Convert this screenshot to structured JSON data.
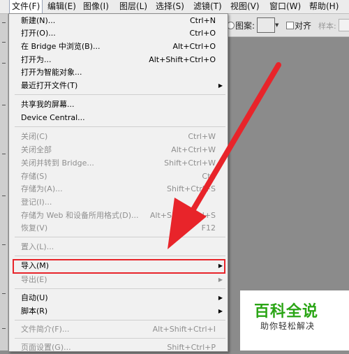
{
  "menubar": {
    "items": [
      {
        "label": "文件(F)"
      },
      {
        "label": "编辑(E)"
      },
      {
        "label": "图像(I)"
      },
      {
        "label": "图层(L)"
      },
      {
        "label": "选择(S)"
      },
      {
        "label": "滤镜(T)"
      },
      {
        "label": "视图(V)"
      },
      {
        "label": "窗口(W)"
      },
      {
        "label": "帮助(H)"
      }
    ]
  },
  "options_bar": {
    "pattern_label": "图案:",
    "align_label": "对齐",
    "sample_label": "样本:"
  },
  "file_menu": {
    "items": [
      {
        "label": "新建(N)...",
        "shortcut": "Ctrl+N",
        "disabled": false
      },
      {
        "label": "打开(O)...",
        "shortcut": "Ctrl+O",
        "disabled": false
      },
      {
        "label": "在 Bridge 中浏览(B)...",
        "shortcut": "Alt+Ctrl+O",
        "disabled": false
      },
      {
        "label": "打开为...",
        "shortcut": "Alt+Shift+Ctrl+O",
        "disabled": false
      },
      {
        "label": "打开为智能对象...",
        "shortcut": "",
        "disabled": false
      },
      {
        "label": "最近打开文件(T)",
        "shortcut": "",
        "disabled": false,
        "submenu": true
      },
      {
        "label": "共享我的屏幕...",
        "shortcut": "",
        "disabled": false
      },
      {
        "label": "Device Central...",
        "shortcut": "",
        "disabled": false
      },
      {
        "label": "关闭(C)",
        "shortcut": "Ctrl+W",
        "disabled": true
      },
      {
        "label": "关闭全部",
        "shortcut": "Alt+Ctrl+W",
        "disabled": true
      },
      {
        "label": "关闭并转到 Bridge...",
        "shortcut": "Shift+Ctrl+W",
        "disabled": true
      },
      {
        "label": "存储(S)",
        "shortcut": "Ctrl",
        "disabled": true
      },
      {
        "label": "存储为(A)...",
        "shortcut": "Shift+Ctrl+S",
        "disabled": true
      },
      {
        "label": "登记(I)...",
        "shortcut": "",
        "disabled": true
      },
      {
        "label": "存储为 Web 和设备所用格式(D)...",
        "shortcut": "Alt+Shift+Ctrl+S",
        "disabled": true
      },
      {
        "label": "恢复(V)",
        "shortcut": "F12",
        "disabled": true
      },
      {
        "label": "置入(L)...",
        "shortcut": "",
        "disabled": true
      },
      {
        "label": "导入(M)",
        "shortcut": "",
        "disabled": false,
        "submenu": true,
        "highlighted": true
      },
      {
        "label": "导出(E)",
        "shortcut": "",
        "disabled": true,
        "submenu": true
      },
      {
        "label": "自动(U)",
        "shortcut": "",
        "disabled": false,
        "submenu": true
      },
      {
        "label": "脚本(R)",
        "shortcut": "",
        "disabled": false,
        "submenu": true
      },
      {
        "label": "文件简介(F)...",
        "shortcut": "Alt+Shift+Ctrl+I",
        "disabled": true
      },
      {
        "label": "页面设置(G)...",
        "shortcut": "Shift+Ctrl+P",
        "disabled": true
      }
    ]
  },
  "submenu_glyph": "▶",
  "watermark": {
    "title": "百科全说",
    "subtitle": "助你轻松解决"
  },
  "colors": {
    "annotation_red": "#e8242a",
    "watermark_green": "#2aa515"
  }
}
